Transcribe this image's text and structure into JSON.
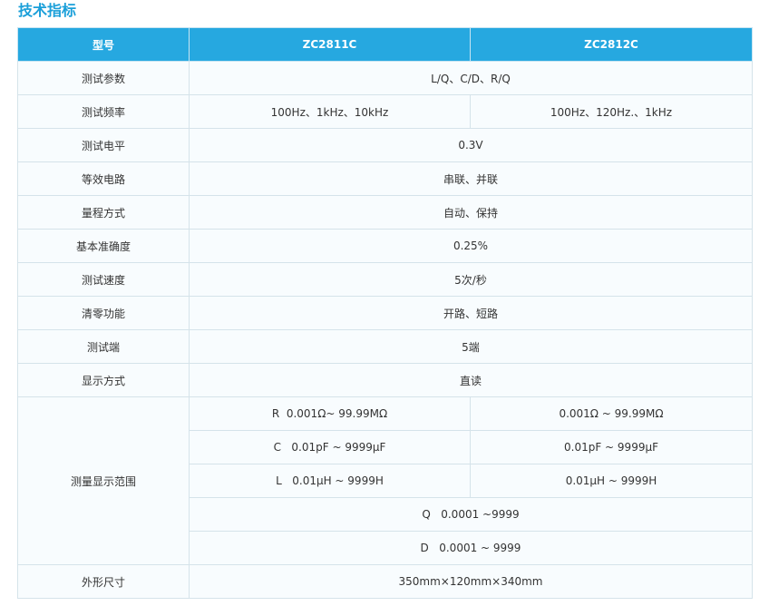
{
  "title": "技术指标",
  "header": {
    "col_label": "型号",
    "model_a": "ZC2811C",
    "model_b": "ZC2812C"
  },
  "rows": {
    "test_params": {
      "label": "测试参数",
      "value": "L/Q、C/D、R/Q"
    },
    "test_freq": {
      "label": "测试频率",
      "a": "100Hz、1kHz、10kHz",
      "b": "100Hz、120Hz.、1kHz"
    },
    "test_level": {
      "label": "测试电平",
      "value": "0.3V"
    },
    "equiv_circuit": {
      "label": "等效电路",
      "value": "串联、并联"
    },
    "range_mode": {
      "label": "量程方式",
      "value": "自动、保持"
    },
    "basic_accuracy": {
      "label": "基本准确度",
      "value": "0.25%"
    },
    "test_speed": {
      "label": "测试速度",
      "value": "5次/秒"
    },
    "zero_function": {
      "label": "清零功能",
      "value": "开路、短路"
    },
    "test_terminal": {
      "label": "测试端",
      "value": "5端"
    },
    "display_mode": {
      "label": "显示方式",
      "value": "直读"
    },
    "display_range": {
      "label": "测量显示范围",
      "r_a": "R  0.001Ω~ 99.99MΩ",
      "r_b": "0.001Ω ~ 99.99MΩ",
      "c_a": "C   0.01pF ~ 9999μF",
      "c_b": "0.01pF ~ 9999μF",
      "l_a": "L   0.01μH ~ 9999H",
      "l_b": "0.01μH ~ 9999H",
      "q": "Q   0.0001 ~9999",
      "d": "D   0.0001 ~ 9999"
    },
    "dimensions": {
      "label": "外形尺寸",
      "value": "350mm×120mm×340mm"
    }
  }
}
